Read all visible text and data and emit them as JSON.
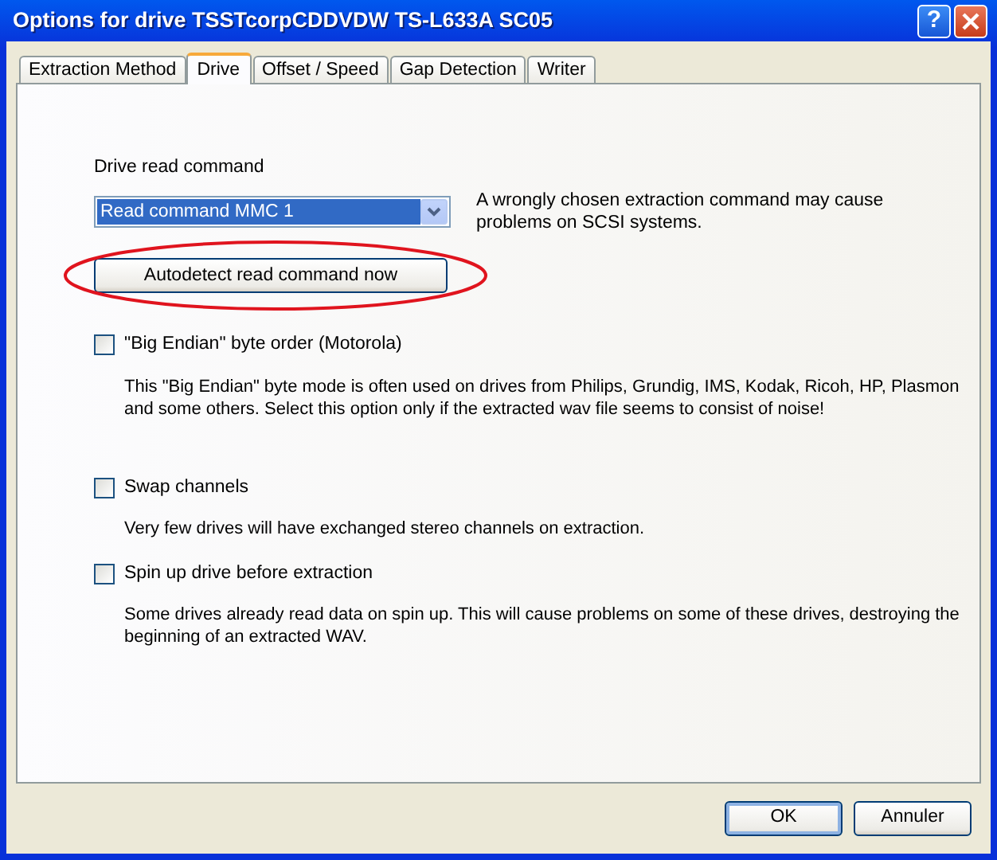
{
  "window": {
    "title": "Options for drive TSSTcorpCDDVDW TS-L633A SC05",
    "help_button": "?"
  },
  "tabs": [
    {
      "label": "Extraction Method",
      "selected": false
    },
    {
      "label": "Drive",
      "selected": true
    },
    {
      "label": "Offset / Speed",
      "selected": false
    },
    {
      "label": "Gap Detection",
      "selected": false
    },
    {
      "label": "Writer",
      "selected": false
    }
  ],
  "drive_read_command": {
    "label": "Drive read command",
    "value": "Read command MMC 1",
    "note": "A wrongly chosen extraction command may cause problems on SCSI systems."
  },
  "autodetect_button": {
    "label": "Autodetect read command now",
    "highlighted": true
  },
  "options": [
    {
      "label": "\"Big Endian\" byte order (Motorola)",
      "checked": false,
      "description": "This \"Big Endian\" byte mode is often used on drives from Philips, Grundig, IMS, Kodak, Ricoh, HP, Plasmon and some others. Select this option only if the extracted wav file seems to consist of noise!"
    },
    {
      "label": "Swap channels",
      "checked": false,
      "description": "Very few drives will have exchanged stereo channels on extraction."
    },
    {
      "label": "Spin up drive before extraction",
      "checked": false,
      "description": "Some drives already read data on spin up. This will cause problems on some of these drives, destroying the beginning of an extracted WAV."
    }
  ],
  "buttons": [
    {
      "label": "OK",
      "default": true
    },
    {
      "label": "Annuler",
      "default": false
    }
  ]
}
